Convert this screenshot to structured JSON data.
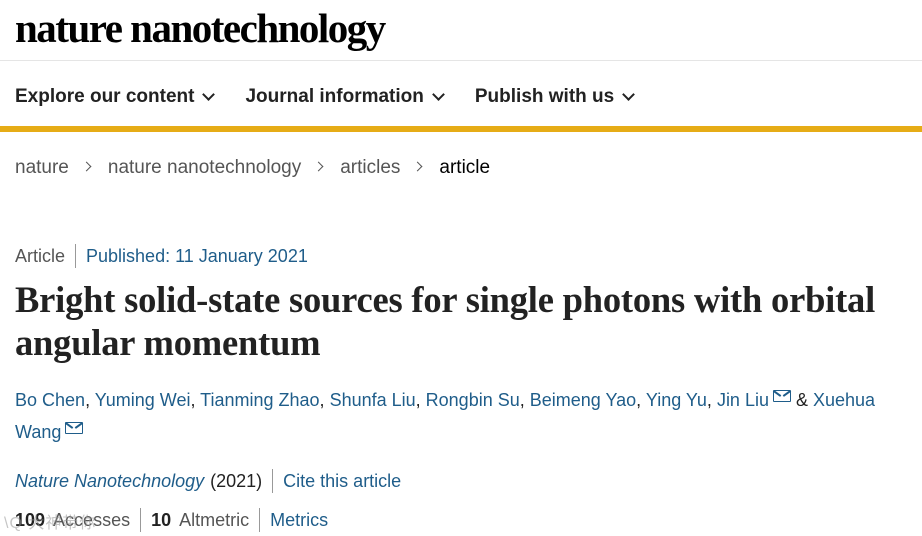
{
  "header": {
    "logo": "nature nanotechnology"
  },
  "nav": [
    {
      "label": "Explore our content"
    },
    {
      "label": "Journal information"
    },
    {
      "label": "Publish with us"
    }
  ],
  "breadcrumb": [
    "nature",
    "nature nanotechnology",
    "articles",
    "article"
  ],
  "article": {
    "type": "Article",
    "published": "Published: 11 January 2021",
    "title": "Bright solid-state sources for single photons with orbital angular momentum",
    "authors": [
      "Bo Chen",
      "Yuming Wei",
      "Tianming Zhao",
      "Shunfa Liu",
      "Rongbin Su",
      "Beimeng Yao",
      "Ying Yu",
      "Jin Liu",
      "Xuehua Wang"
    ],
    "author_sep": ", ",
    "and": " & ",
    "journal": "Nature Nanotechnology",
    "year": "(2021)",
    "cite": "Cite this article"
  },
  "metrics": {
    "accesses_count": "109",
    "accesses_label": "Accesses",
    "altmetric_count": "10",
    "altmetric_label": "Altmetric",
    "metrics_link": "Metrics"
  },
  "watermark": "\\Q 大神带你"
}
